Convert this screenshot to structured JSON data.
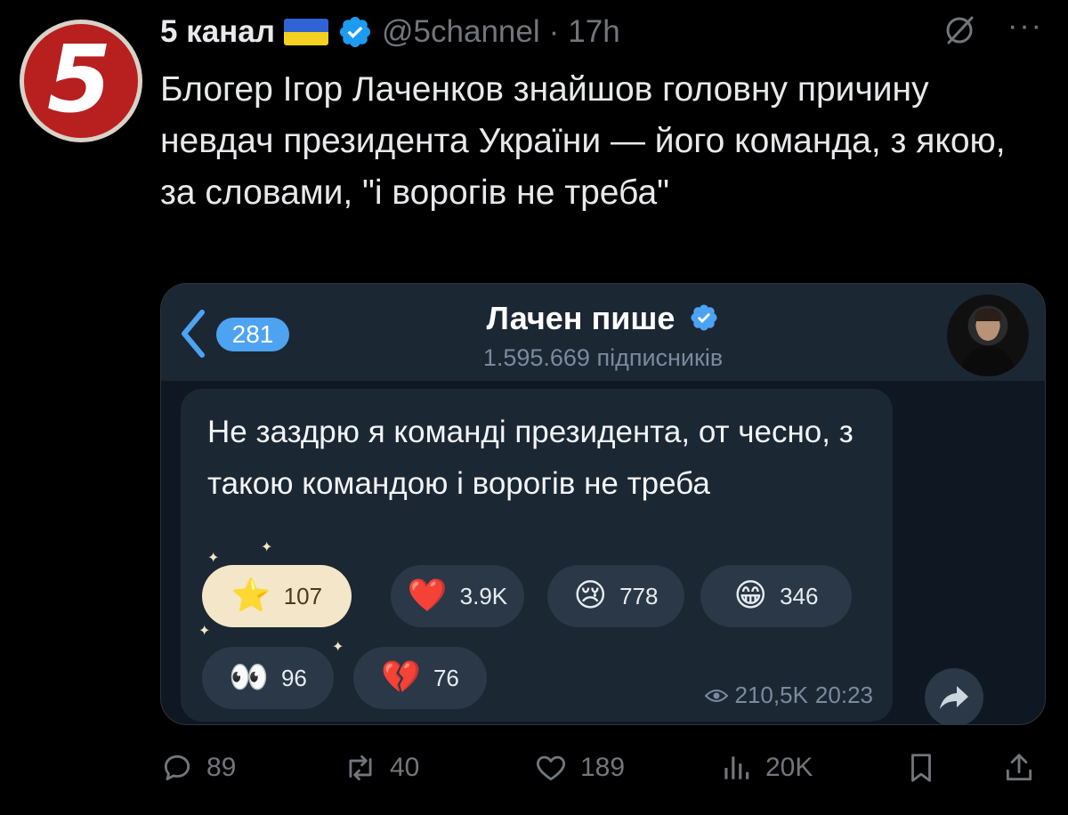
{
  "tweet": {
    "avatar_glyph": "5",
    "display_name": "5 канал",
    "handle": "@5channel",
    "separator": "·",
    "time": "17h",
    "more": "···",
    "text": "Блогер Ігор Лаченков знайшов головну причину невдач президента України — його команда, з якою, за словами, \"і ворогів не треба\""
  },
  "telegram": {
    "unread_count": "281",
    "channel_name": "Лачен пише",
    "subscribers": "1.595.669 підписників",
    "message": "Не заздрю я команді президента, от чесно, з такою командою і ворогів не треба",
    "reactions": [
      {
        "emoji": "⭐",
        "count": "107"
      },
      {
        "emoji": "❤️",
        "count": "3.9K"
      },
      {
        "emoji": "😢",
        "count": "778"
      },
      {
        "emoji": "😁",
        "count": "346"
      },
      {
        "emoji": "👀",
        "count": "96"
      },
      {
        "emoji": "💔",
        "count": "76"
      }
    ],
    "views": "210,5K",
    "time": "20:23"
  },
  "actions": {
    "replies": "89",
    "retweets": "40",
    "likes": "189",
    "views": "20K"
  },
  "colors": {
    "background": "#000000",
    "avatar_red": "#b81f1f",
    "verified_blue": "#1d9bf0",
    "telegram_accent": "#4da3f2",
    "muted_text": "#71767b"
  }
}
